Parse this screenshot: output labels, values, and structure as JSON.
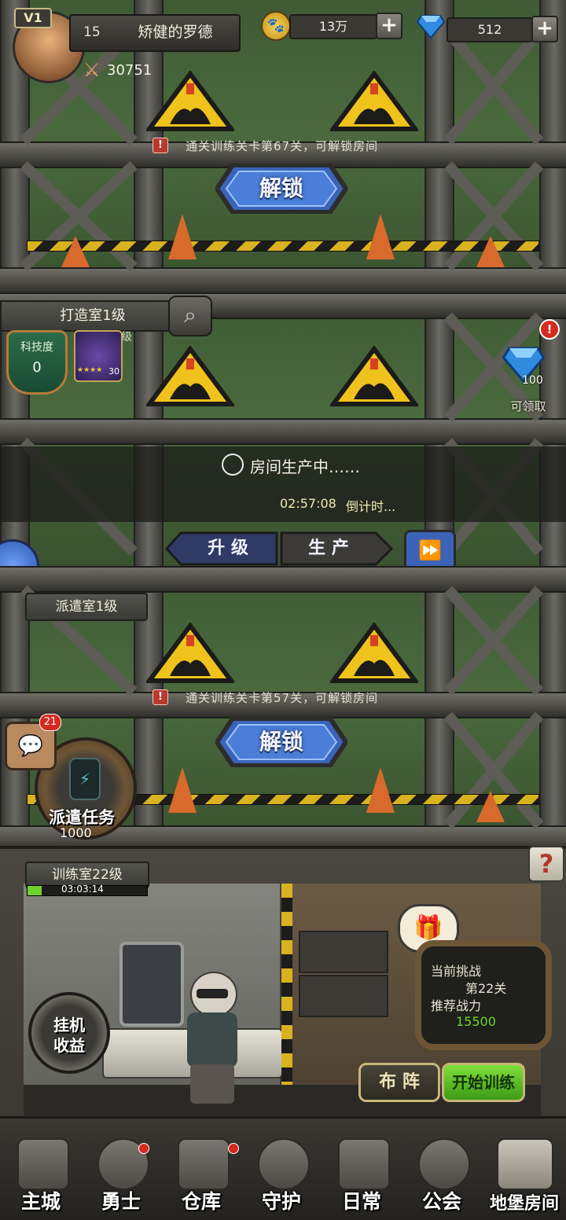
{
  "player": {
    "vip": "V1",
    "level": "15",
    "name": "矫健的罗德",
    "power": "30751"
  },
  "resources": {
    "paw_amount": "13万",
    "gem_amount": "512"
  },
  "room1": {
    "unlock_hint": "通关训练关卡第67关，可解锁房间",
    "unlock_label": "解锁"
  },
  "forge": {
    "title": "打造室1级",
    "tech_label": "科技度",
    "tech_value": "0",
    "item_count": "30",
    "item_suffix": "级",
    "status": "房间生产中……",
    "countdown": "02:57:08",
    "countdown_suffix": "倒计时...",
    "upgrade_label": "升 级",
    "produce_label": "生 产"
  },
  "reward": {
    "amount": "100",
    "claim_label": "可领取"
  },
  "dispatch": {
    "title": "派遣室1级",
    "unlock_hint": "通关训练关卡第57关，可解锁房间",
    "unlock_label": "解锁",
    "task_label": "派遣任务",
    "task_value": "1000",
    "chat_badge": "21"
  },
  "training": {
    "title": "训练室22级",
    "timer": "03:03:14",
    "idle_label_1": "挂机",
    "idle_label_2": "收益",
    "challenge_label": "当前挑战",
    "stage": "第22关",
    "rec_power_label": "推荐战力",
    "rec_power": "15500",
    "formation_label": "布 阵",
    "start_label": "开始训练",
    "help": "?"
  },
  "nav": [
    {
      "label": "主城",
      "icon": "castle-icon"
    },
    {
      "label": "勇士",
      "icon": "warrior-icon"
    },
    {
      "label": "仓库",
      "icon": "warehouse-icon"
    },
    {
      "label": "守护",
      "icon": "guardian-icon"
    },
    {
      "label": "日常",
      "icon": "daily-icon"
    },
    {
      "label": "公会",
      "icon": "guild-icon"
    },
    {
      "label": "地堡房间",
      "icon": "bunker-icon"
    }
  ],
  "colors": {
    "accent_green": "#6fd22c",
    "gem_blue": "#2f8be0",
    "unlock_blue": "#3b64b8",
    "hazard_yellow": "#f0c21c"
  }
}
